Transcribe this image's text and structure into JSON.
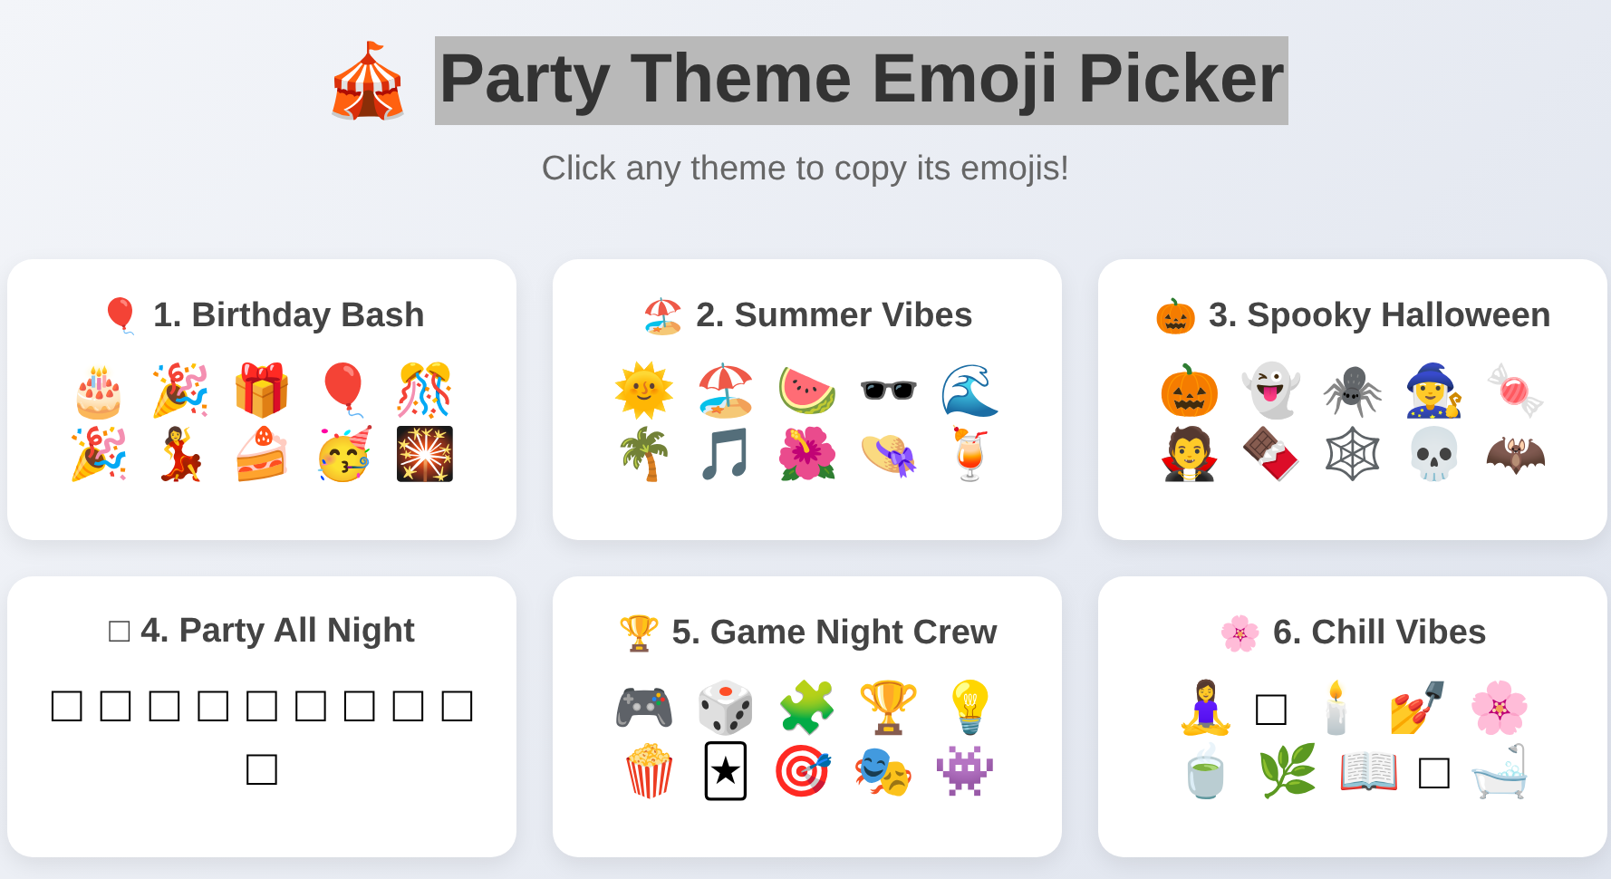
{
  "header": {
    "icon": "🎪",
    "title": "Party Theme Emoji Picker",
    "highlighted": true,
    "subtitle": "Click any theme to copy its emojis!"
  },
  "themes": [
    {
      "icon": "🎈",
      "title": "1. Birthday Bash",
      "emojis": [
        "🎂",
        "🎉",
        "🎁",
        "🎈",
        "🎊",
        "🎉",
        "💃",
        "🍰",
        "🥳",
        "🎇"
      ]
    },
    {
      "icon": "🏖️",
      "title": "2. Summer Vibes",
      "emojis": [
        "🌞",
        "🏖️",
        "🍉",
        "🕶️",
        "🌊",
        "🌴",
        "🎵",
        "🌺",
        "👒",
        "🍹"
      ]
    },
    {
      "icon": "🎃",
      "title": "3. Spooky Halloween",
      "emojis": [
        "🎃",
        "👻",
        "🕷️",
        "🧙‍♀️",
        "🍬",
        "🧛",
        "🍫",
        "🕸️",
        "💀",
        "🦇"
      ]
    },
    {
      "icon": "□",
      "title": "4. Party All Night",
      "emojis": [
        "□",
        "□",
        "□",
        "□",
        "□",
        "□",
        "□",
        "□",
        "□",
        "□"
      ]
    },
    {
      "icon": "🏆",
      "title": "5. Game Night Crew",
      "emojis": [
        "🎮",
        "🎲",
        "🧩",
        "🏆",
        "💡",
        "🍿",
        "🃏",
        "🎯",
        "🎭",
        "👾"
      ]
    },
    {
      "icon": "🌸",
      "title": "6. Chill Vibes",
      "emojis": [
        "🧘‍♀️",
        "□",
        "🕯️",
        "💅",
        "🌸",
        "🍵",
        "🌿",
        "📖",
        "□",
        "🛁"
      ]
    }
  ]
}
